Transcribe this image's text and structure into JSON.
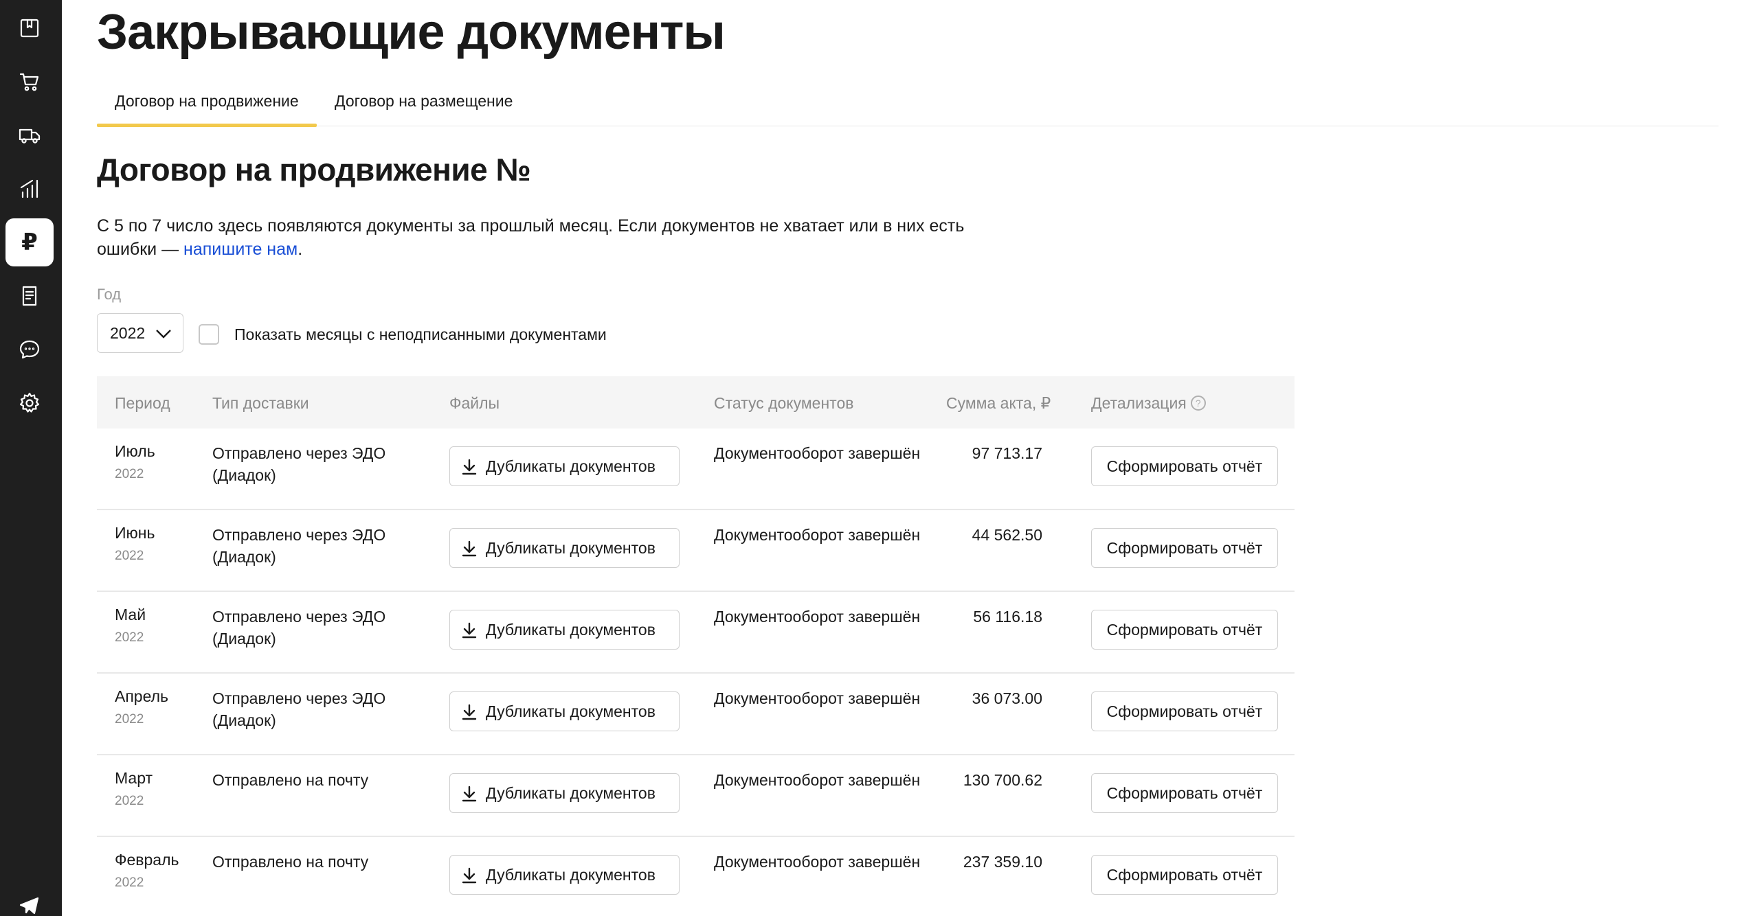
{
  "sidebar": {
    "items": [
      {
        "icon": "bookmark-icon",
        "active": false
      },
      {
        "icon": "cart-icon",
        "active": false
      },
      {
        "icon": "truck-icon",
        "active": false
      },
      {
        "icon": "analytics-icon",
        "active": false
      },
      {
        "icon": "ruble-icon",
        "active": true,
        "glyph": "₽"
      },
      {
        "icon": "document-icon",
        "active": false
      },
      {
        "icon": "chat-icon",
        "active": false
      },
      {
        "icon": "gear-icon",
        "active": false
      },
      {
        "icon": "telegram-icon",
        "active": false
      }
    ]
  },
  "page": {
    "title": "Закрывающие документы"
  },
  "tabs": [
    {
      "label": "Договор на продвижение",
      "active": true
    },
    {
      "label": "Договор на размещение",
      "active": false
    }
  ],
  "section": {
    "title": "Договор на продвижение №",
    "info_text": "С 5 по 7 число здесь появляются документы за прошлый месяц. Если документов не хватает или в них есть ошибки — ",
    "info_link": "напишите нам",
    "info_end": "."
  },
  "filters": {
    "year_label": "Год",
    "year_value": "2022",
    "checkbox_label": "Показать месяцы с неподписанными документами",
    "checkbox_checked": false
  },
  "table": {
    "headers": {
      "period": "Период",
      "delivery": "Тип доставки",
      "files": "Файлы",
      "status": "Статус документов",
      "amount": "Сумма акта, ₽",
      "details": "Детализация",
      "help": "?"
    },
    "rows": [
      {
        "month": "Июль",
        "year": "2022",
        "delivery": "Отправлено через ЭДО (Диадок)",
        "files_button": "Дубликаты документов",
        "status": "Документооборот завершён",
        "amount": "97 713.17",
        "report_button": "Сформировать отчёт"
      },
      {
        "month": "Июнь",
        "year": "2022",
        "delivery": "Отправлено через ЭДО (Диадок)",
        "files_button": "Дубликаты документов",
        "status": "Документооборот завершён",
        "amount": "44 562.50",
        "report_button": "Сформировать отчёт"
      },
      {
        "month": "Май",
        "year": "2022",
        "delivery": "Отправлено через ЭДО (Диадок)",
        "files_button": "Дубликаты документов",
        "status": "Документооборот завершён",
        "amount": "56 116.18",
        "report_button": "Сформировать отчёт"
      },
      {
        "month": "Апрель",
        "year": "2022",
        "delivery": "Отправлено через ЭДО (Диадок)",
        "files_button": "Дубликаты документов",
        "status": "Документооборот завершён",
        "amount": "36 073.00",
        "report_button": "Сформировать отчёт"
      },
      {
        "month": "Март",
        "year": "2022",
        "delivery": "Отправлено на почту",
        "files_button": "Дубликаты документов",
        "status": "Документооборот завершён",
        "amount": "130 700.62",
        "report_button": "Сформировать отчёт"
      },
      {
        "month": "Февраль",
        "year": "2022",
        "delivery": "Отправлено на почту",
        "files_button": "Дубликаты документов",
        "status": "Документооборот завершён",
        "amount": "237 359.10",
        "report_button": "Сформировать отчёт"
      }
    ]
  }
}
